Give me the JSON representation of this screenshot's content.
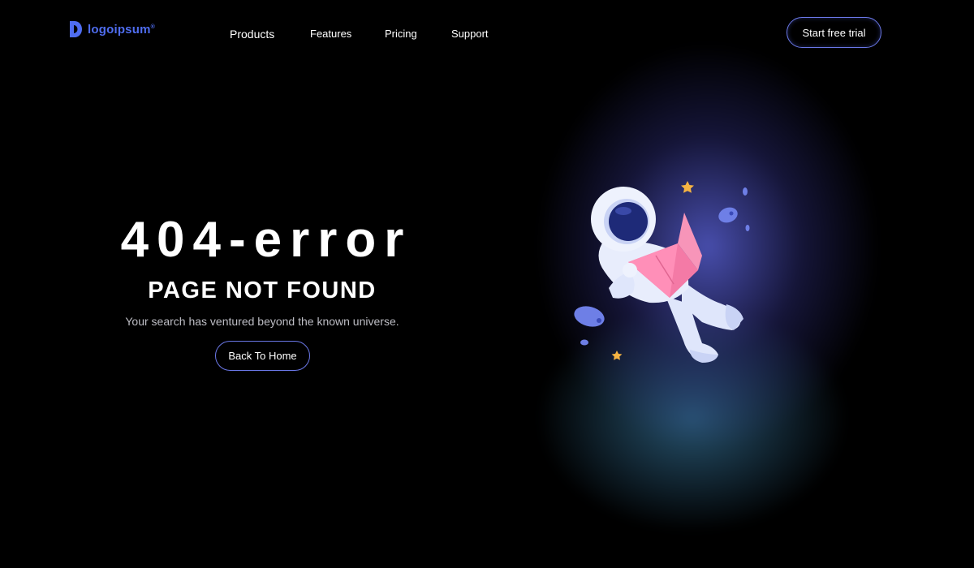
{
  "brand": {
    "logo_text": "logoipsum",
    "accent": "#4f6df0"
  },
  "nav": {
    "items": [
      "Products",
      "Features",
      "Pricing",
      "Support"
    ]
  },
  "header": {
    "cta_label": "Start free trial"
  },
  "hero": {
    "title": "404-error",
    "subtitle": "PAGE NOT FOUND",
    "description": "Your search has ventured beyond the known universe.",
    "button_label": "Back To Home"
  },
  "illustration": {
    "icon": "astronaut-reading-icon"
  }
}
